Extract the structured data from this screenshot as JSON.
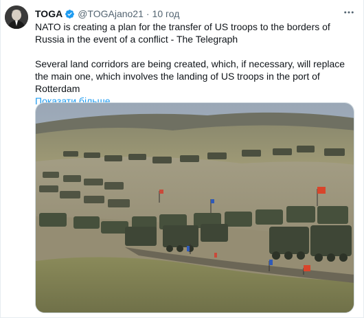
{
  "tweet": {
    "author_name": "TOGA",
    "handle": "@TOGAjano21",
    "separator": "·",
    "time": "10 год",
    "text_line1": "NATO is creating a plan for the transfer of US troops to the borders of Russia in the event of a conflict - The Telegraph",
    "text_line2": "Several land corridors are being created, which, if necessary, will replace the main one, which involves the landing of US troops in the port of Rotterdam",
    "show_more": "Показати більше",
    "more_glyph": "···"
  },
  "icons": {
    "verified": "verified-badge-icon",
    "more": "more-options-icon"
  },
  "colors": {
    "accent": "#1d9bf0",
    "text": "#0f1419",
    "muted": "#536471"
  }
}
